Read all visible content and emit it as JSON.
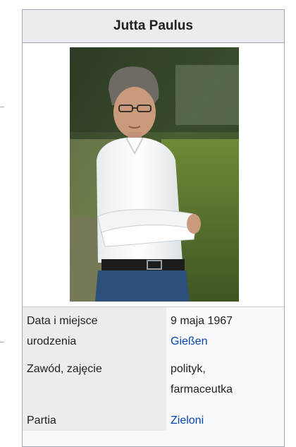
{
  "infobox": {
    "title": "Jutta Paulus",
    "rows": [
      {
        "label_lines": [
          "Data i miejsce",
          "urodzenia"
        ],
        "value_lines": [
          "9 maja 1967",
          "Gießen"
        ]
      },
      {
        "label_lines": [
          "Zawód, zajęcie"
        ],
        "value_lines": [
          "polityk,",
          "farmaceutka"
        ]
      },
      {
        "label_lines": [
          "Partia"
        ],
        "value_lines": [
          "Zieloni"
        ]
      }
    ]
  },
  "colors": {
    "link": "#0645ad",
    "header_bg": "#eaecf0",
    "border": "#a2a9b1"
  }
}
